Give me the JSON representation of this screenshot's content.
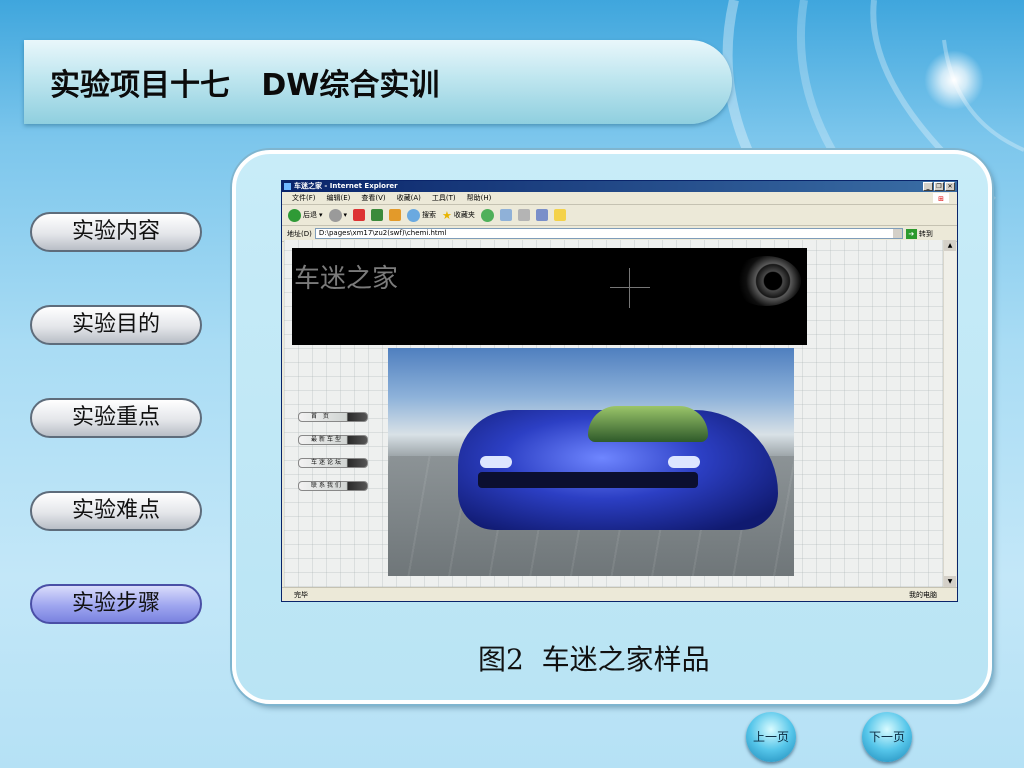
{
  "slide": {
    "title": "实验项目十七   DW综合实训",
    "nav": [
      {
        "label": "实验内容"
      },
      {
        "label": "实验目的"
      },
      {
        "label": "实验重点"
      },
      {
        "label": "实验难点"
      },
      {
        "label": "实验步骤",
        "active": true
      }
    ],
    "caption": "图2  车迷之家样品",
    "prev_label": "上一页",
    "next_label": "下一页"
  },
  "browser": {
    "title": "车迷之家 - Internet Explorer",
    "menu": [
      "文件(F)",
      "编辑(E)",
      "查看(V)",
      "收藏(A)",
      "工具(T)",
      "帮助(H)"
    ],
    "toolbar": {
      "back": "后退",
      "search": "搜索",
      "favorites": "收藏夹"
    },
    "address_label": "地址(D)",
    "address": "D:\\pages\\xm17\\zu2(swf)\\chemi.html",
    "go_label": "转到",
    "status": "完毕",
    "zone": "我的电脑"
  },
  "site": {
    "banner_title": "车迷之家",
    "nav": [
      "首 页",
      "最新车型",
      "车迷论坛",
      "联系我们"
    ]
  }
}
